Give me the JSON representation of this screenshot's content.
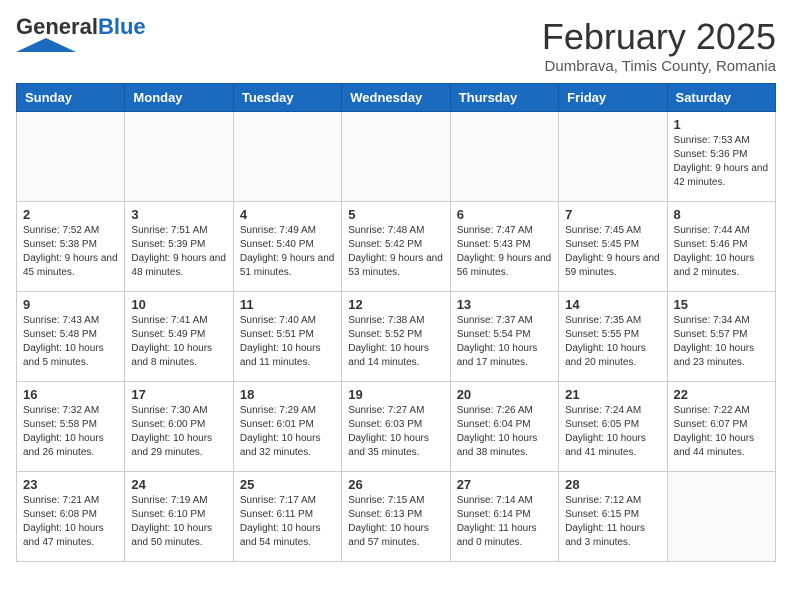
{
  "header": {
    "logo_general": "General",
    "logo_blue": "Blue",
    "title": "February 2025",
    "subtitle": "Dumbrava, Timis County, Romania"
  },
  "days_of_week": [
    "Sunday",
    "Monday",
    "Tuesday",
    "Wednesday",
    "Thursday",
    "Friday",
    "Saturday"
  ],
  "weeks": [
    [
      {
        "day": "",
        "info": ""
      },
      {
        "day": "",
        "info": ""
      },
      {
        "day": "",
        "info": ""
      },
      {
        "day": "",
        "info": ""
      },
      {
        "day": "",
        "info": ""
      },
      {
        "day": "",
        "info": ""
      },
      {
        "day": "1",
        "info": "Sunrise: 7:53 AM\nSunset: 5:36 PM\nDaylight: 9 hours and 42 minutes."
      }
    ],
    [
      {
        "day": "2",
        "info": "Sunrise: 7:52 AM\nSunset: 5:38 PM\nDaylight: 9 hours and 45 minutes."
      },
      {
        "day": "3",
        "info": "Sunrise: 7:51 AM\nSunset: 5:39 PM\nDaylight: 9 hours and 48 minutes."
      },
      {
        "day": "4",
        "info": "Sunrise: 7:49 AM\nSunset: 5:40 PM\nDaylight: 9 hours and 51 minutes."
      },
      {
        "day": "5",
        "info": "Sunrise: 7:48 AM\nSunset: 5:42 PM\nDaylight: 9 hours and 53 minutes."
      },
      {
        "day": "6",
        "info": "Sunrise: 7:47 AM\nSunset: 5:43 PM\nDaylight: 9 hours and 56 minutes."
      },
      {
        "day": "7",
        "info": "Sunrise: 7:45 AM\nSunset: 5:45 PM\nDaylight: 9 hours and 59 minutes."
      },
      {
        "day": "8",
        "info": "Sunrise: 7:44 AM\nSunset: 5:46 PM\nDaylight: 10 hours and 2 minutes."
      }
    ],
    [
      {
        "day": "9",
        "info": "Sunrise: 7:43 AM\nSunset: 5:48 PM\nDaylight: 10 hours and 5 minutes."
      },
      {
        "day": "10",
        "info": "Sunrise: 7:41 AM\nSunset: 5:49 PM\nDaylight: 10 hours and 8 minutes."
      },
      {
        "day": "11",
        "info": "Sunrise: 7:40 AM\nSunset: 5:51 PM\nDaylight: 10 hours and 11 minutes."
      },
      {
        "day": "12",
        "info": "Sunrise: 7:38 AM\nSunset: 5:52 PM\nDaylight: 10 hours and 14 minutes."
      },
      {
        "day": "13",
        "info": "Sunrise: 7:37 AM\nSunset: 5:54 PM\nDaylight: 10 hours and 17 minutes."
      },
      {
        "day": "14",
        "info": "Sunrise: 7:35 AM\nSunset: 5:55 PM\nDaylight: 10 hours and 20 minutes."
      },
      {
        "day": "15",
        "info": "Sunrise: 7:34 AM\nSunset: 5:57 PM\nDaylight: 10 hours and 23 minutes."
      }
    ],
    [
      {
        "day": "16",
        "info": "Sunrise: 7:32 AM\nSunset: 5:58 PM\nDaylight: 10 hours and 26 minutes."
      },
      {
        "day": "17",
        "info": "Sunrise: 7:30 AM\nSunset: 6:00 PM\nDaylight: 10 hours and 29 minutes."
      },
      {
        "day": "18",
        "info": "Sunrise: 7:29 AM\nSunset: 6:01 PM\nDaylight: 10 hours and 32 minutes."
      },
      {
        "day": "19",
        "info": "Sunrise: 7:27 AM\nSunset: 6:03 PM\nDaylight: 10 hours and 35 minutes."
      },
      {
        "day": "20",
        "info": "Sunrise: 7:26 AM\nSunset: 6:04 PM\nDaylight: 10 hours and 38 minutes."
      },
      {
        "day": "21",
        "info": "Sunrise: 7:24 AM\nSunset: 6:05 PM\nDaylight: 10 hours and 41 minutes."
      },
      {
        "day": "22",
        "info": "Sunrise: 7:22 AM\nSunset: 6:07 PM\nDaylight: 10 hours and 44 minutes."
      }
    ],
    [
      {
        "day": "23",
        "info": "Sunrise: 7:21 AM\nSunset: 6:08 PM\nDaylight: 10 hours and 47 minutes."
      },
      {
        "day": "24",
        "info": "Sunrise: 7:19 AM\nSunset: 6:10 PM\nDaylight: 10 hours and 50 minutes."
      },
      {
        "day": "25",
        "info": "Sunrise: 7:17 AM\nSunset: 6:11 PM\nDaylight: 10 hours and 54 minutes."
      },
      {
        "day": "26",
        "info": "Sunrise: 7:15 AM\nSunset: 6:13 PM\nDaylight: 10 hours and 57 minutes."
      },
      {
        "day": "27",
        "info": "Sunrise: 7:14 AM\nSunset: 6:14 PM\nDaylight: 11 hours and 0 minutes."
      },
      {
        "day": "28",
        "info": "Sunrise: 7:12 AM\nSunset: 6:15 PM\nDaylight: 11 hours and 3 minutes."
      },
      {
        "day": "",
        "info": ""
      }
    ]
  ]
}
